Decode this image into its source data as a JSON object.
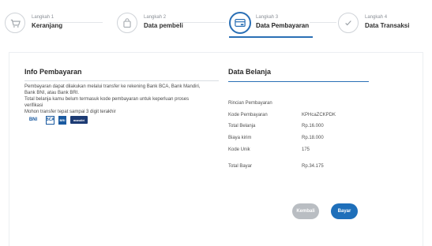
{
  "stepper": {
    "steps": [
      {
        "sub": "Langkah 1",
        "label": "Keranjang",
        "icon": "cart-icon"
      },
      {
        "sub": "Langkah 2",
        "label": "Data pembeli",
        "icon": "bag-icon"
      },
      {
        "sub": "Langkah 3",
        "label": "Data Pembayaran",
        "icon": "card-icon",
        "active": true
      },
      {
        "sub": "Langkah 4",
        "label": "Data Transaksi",
        "icon": "check-icon"
      }
    ]
  },
  "info": {
    "title": "Info Pembayaran",
    "lines": [
      "Pembayaran dapat dilakukan melalui transfer ke rekening Bank BCA, Bank Mandiri,",
      "Bank BNI, atau Bank BRI.",
      "Total belanja kamu belum termasuk kode pembayaran untuk keperluan proses",
      "verifikasi",
      "Mohon transfer tepat sampai 3 digit terakhir"
    ],
    "banks": [
      "BNI",
      "BCA",
      "BRI",
      "mandiri"
    ]
  },
  "belanja": {
    "title": "Data Belanja",
    "rincian_label": "Rincian Pembayaran",
    "rows": [
      {
        "label": "Kode Pembayaran",
        "value": "KPHcaZCKPDK"
      },
      {
        "label": "Total Belanja",
        "value": "Rp.16.000"
      },
      {
        "label": "Biaya kirim",
        "value": "Rp.18.000"
      },
      {
        "label": "Kode Unik",
        "value": "175"
      }
    ],
    "total": {
      "label": "Total Bayar",
      "value": "Rp.34.175"
    }
  },
  "buttons": {
    "back": "Kembali",
    "pay": "Bayar"
  },
  "colors": {
    "accent": "#1e6fba",
    "muted_button": "#b9bdc2"
  }
}
